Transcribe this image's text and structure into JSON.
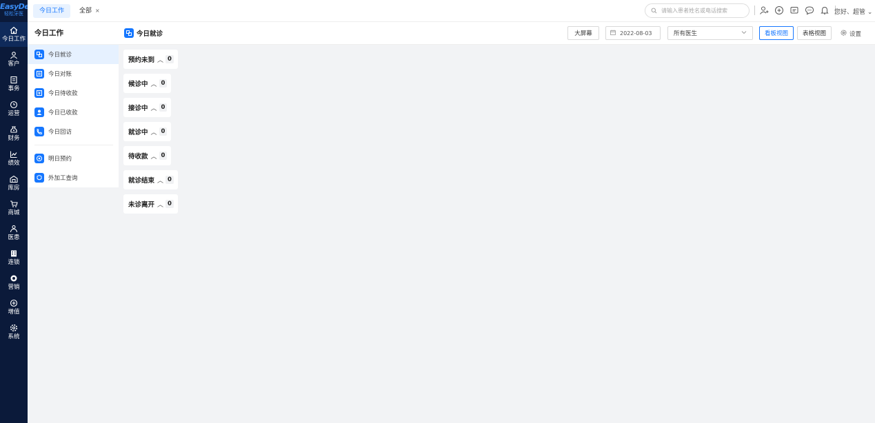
{
  "nav": {
    "logo_text": "EasyDent",
    "logo_sub": "轻松牙医",
    "items": [
      {
        "label": "今日工作",
        "icon": "home-icon"
      },
      {
        "label": "客户",
        "icon": "user-icon"
      },
      {
        "label": "事务",
        "icon": "task-icon"
      },
      {
        "label": "运营",
        "icon": "clock-icon"
      },
      {
        "label": "财务",
        "icon": "money-bag-icon"
      },
      {
        "label": "绩效",
        "icon": "chart-icon"
      },
      {
        "label": "库房",
        "icon": "warehouse-icon"
      },
      {
        "label": "商城",
        "icon": "cart-icon"
      },
      {
        "label": "医患",
        "icon": "doctor-icon"
      },
      {
        "label": "连锁",
        "icon": "building-icon"
      },
      {
        "label": "营销",
        "icon": "marketing-icon"
      },
      {
        "label": "增值",
        "icon": "value-add-icon"
      },
      {
        "label": "系统",
        "icon": "settings-icon"
      }
    ]
  },
  "tabs": [
    {
      "label": "今日工作"
    },
    {
      "label": "全部",
      "close": "×"
    }
  ],
  "search": {
    "placeholder": "请输入患者姓名或电话搜索"
  },
  "header_icons": [
    "add-user-icon",
    "add-circle-icon",
    "message-icon",
    "chat-icon",
    "bell-icon"
  ],
  "greeting": "您好、超管",
  "subsidebar": {
    "title": "今日工作",
    "items": [
      {
        "label": "今日就诊",
        "icon": "visit-icon"
      },
      {
        "label": "今日对账",
        "icon": "reconcile-icon"
      },
      {
        "label": "今日待收款",
        "icon": "pending-payment-icon"
      },
      {
        "label": "今日已收款",
        "icon": "received-payment-icon"
      },
      {
        "label": "今日回访",
        "icon": "follow-up-icon"
      },
      {
        "label": "明日预约",
        "icon": "appointment-icon"
      },
      {
        "label": "外加工查询",
        "icon": "outsourcing-icon"
      }
    ]
  },
  "content": {
    "title": "今日就诊",
    "big_screen_label": "大屏幕",
    "date": "2022-08-03",
    "doctor_select": "所有医生",
    "board_view_label": "看板视图",
    "table_view_label": "表格视图",
    "settings_label": "设置"
  },
  "status_cards": [
    {
      "label": "预约未到",
      "caret": "^",
      "count": "0"
    },
    {
      "label": "候诊中",
      "caret": "^",
      "count": "0"
    },
    {
      "label": "接诊中",
      "caret": "^",
      "count": "0"
    },
    {
      "label": "就诊中",
      "caret": "^",
      "count": "0"
    },
    {
      "label": "待收款",
      "caret": "^",
      "count": "0"
    },
    {
      "label": "就诊结束",
      "caret": "^",
      "count": "0"
    },
    {
      "label": "未诊离开",
      "caret": "^",
      "count": "0"
    }
  ],
  "colors": {
    "primary": "#1677ff",
    "nav_bg": "#0b1a3a",
    "page_bg": "#f2f3f5"
  }
}
